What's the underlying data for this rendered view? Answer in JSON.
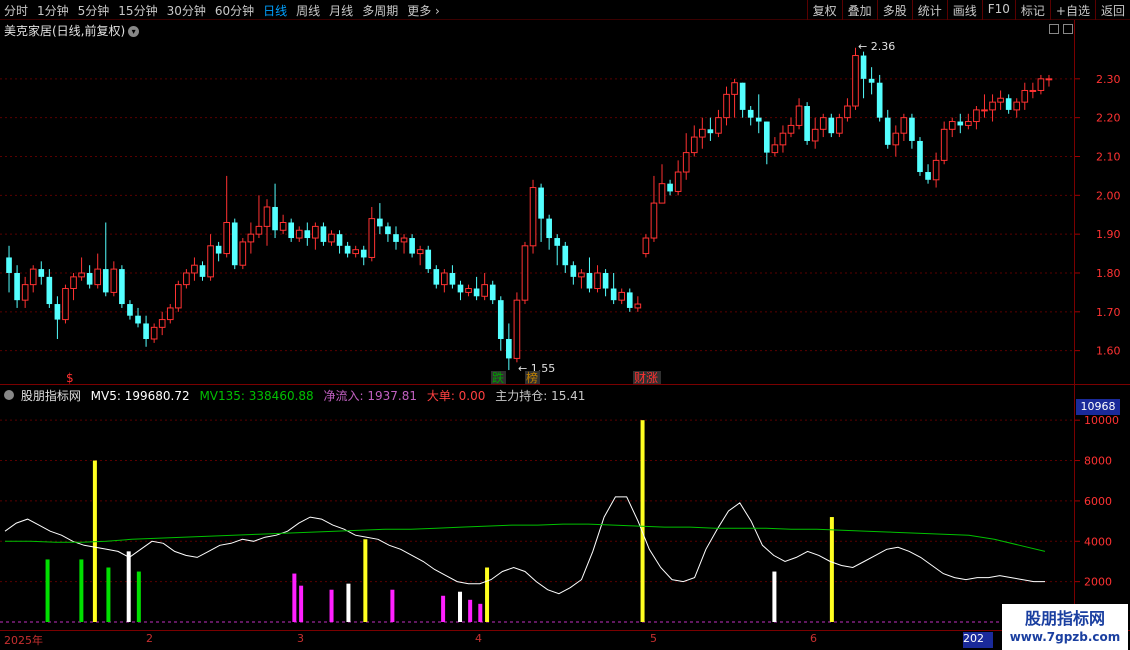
{
  "toolbar": {
    "periods": [
      {
        "label": "分时",
        "active": false
      },
      {
        "label": "1分钟",
        "active": false
      },
      {
        "label": "5分钟",
        "active": false
      },
      {
        "label": "15分钟",
        "active": false
      },
      {
        "label": "30分钟",
        "active": false
      },
      {
        "label": "60分钟",
        "active": false
      },
      {
        "label": "日线",
        "active": true
      },
      {
        "label": "周线",
        "active": false
      },
      {
        "label": "月线",
        "active": false
      },
      {
        "label": "多周期",
        "active": false
      },
      {
        "label": "更多",
        "active": false
      }
    ],
    "buttons": [
      "复权",
      "叠加",
      "多股",
      "统计",
      "画线",
      "F10",
      "标记",
      "+自选",
      "返回"
    ]
  },
  "price_panel": {
    "title": "美克家居(日线,前复权)",
    "y_ticks": [
      "2.30",
      "2.20",
      "2.10",
      "2.00",
      "1.90",
      "1.80",
      "1.70",
      "1.60"
    ],
    "high_label": "2.36",
    "low_label": "1.55",
    "event_labels": [
      {
        "text": "$",
        "color": "#ff3030"
      },
      {
        "text": "跌",
        "color": "#00a000"
      },
      {
        "text": "榜",
        "color": "#c08000"
      },
      {
        "text": "财涨",
        "color": "#ff3030"
      }
    ]
  },
  "indicator": {
    "name": "股朋指标网",
    "mv5": "MV5: 199680.72",
    "mv135": "MV135: 338460.88",
    "net_inflow": "净流入: 1937.81",
    "big_order": "大单: 0.00",
    "main_position": "主力持仓: 15.41",
    "y_ticks": [
      "10000",
      "8000",
      "6000",
      "4000",
      "2000"
    ],
    "current_box": "10968",
    "colors": {
      "mv5": "#ffffff",
      "mv135": "#00c000",
      "net_inflow": "#c060c0",
      "big_order": "#ff4040",
      "main_position": "#c8c8c8"
    }
  },
  "date_axis": {
    "labels": [
      "2025年",
      "2",
      "3",
      "4",
      "5",
      "6"
    ],
    "cursor_box": "202"
  },
  "watermark": {
    "line1": "股朋指标网",
    "line2": "www.7gpzb.com"
  },
  "colors": {
    "up": "#ff3232",
    "down": "#54ffff",
    "grid": "#5a0000",
    "axis_text": "#ff3232"
  },
  "chart_data": [
    {
      "type": "candlestick",
      "price_range": [
        1.55,
        2.36
      ],
      "ylim": [
        1.545,
        2.4
      ],
      "candles": [
        [
          1.84,
          1.8,
          1.87,
          1.75
        ],
        [
          1.8,
          1.73,
          1.82,
          1.71
        ],
        [
          1.73,
          1.77,
          1.79,
          1.71
        ],
        [
          1.77,
          1.81,
          1.82,
          1.75
        ],
        [
          1.81,
          1.79,
          1.83,
          1.77
        ],
        [
          1.79,
          1.72,
          1.81,
          1.71
        ],
        [
          1.72,
          1.68,
          1.74,
          1.63
        ],
        [
          1.68,
          1.76,
          1.77,
          1.67
        ],
        [
          1.76,
          1.79,
          1.8,
          1.73
        ],
        [
          1.79,
          1.8,
          1.84,
          1.78
        ],
        [
          1.8,
          1.77,
          1.82,
          1.76
        ],
        [
          1.77,
          1.81,
          1.85,
          1.76
        ],
        [
          1.81,
          1.75,
          1.93,
          1.74
        ],
        [
          1.75,
          1.81,
          1.83,
          1.74
        ],
        [
          1.81,
          1.72,
          1.82,
          1.71
        ],
        [
          1.72,
          1.69,
          1.73,
          1.68
        ],
        [
          1.69,
          1.67,
          1.71,
          1.66
        ],
        [
          1.67,
          1.63,
          1.69,
          1.61
        ],
        [
          1.63,
          1.66,
          1.67,
          1.62
        ],
        [
          1.66,
          1.68,
          1.7,
          1.64
        ],
        [
          1.68,
          1.71,
          1.72,
          1.67
        ],
        [
          1.71,
          1.77,
          1.78,
          1.7
        ],
        [
          1.77,
          1.8,
          1.81,
          1.76
        ],
        [
          1.8,
          1.82,
          1.84,
          1.78
        ],
        [
          1.82,
          1.79,
          1.83,
          1.78
        ],
        [
          1.79,
          1.87,
          1.9,
          1.78
        ],
        [
          1.87,
          1.85,
          1.88,
          1.83
        ],
        [
          1.85,
          1.93,
          2.05,
          1.84
        ],
        [
          1.93,
          1.82,
          1.94,
          1.81
        ],
        [
          1.82,
          1.88,
          1.89,
          1.81
        ],
        [
          1.88,
          1.9,
          1.93,
          1.85
        ],
        [
          1.9,
          1.92,
          2.0,
          1.89
        ],
        [
          1.92,
          1.97,
          1.99,
          1.87
        ],
        [
          1.97,
          1.91,
          2.03,
          1.89
        ],
        [
          1.91,
          1.93,
          1.95,
          1.9
        ],
        [
          1.93,
          1.89,
          1.94,
          1.88
        ],
        [
          1.89,
          1.91,
          1.92,
          1.88
        ],
        [
          1.91,
          1.89,
          1.93,
          1.87
        ],
        [
          1.89,
          1.92,
          1.93,
          1.86
        ],
        [
          1.92,
          1.88,
          1.93,
          1.87
        ],
        [
          1.88,
          1.9,
          1.91,
          1.87
        ],
        [
          1.9,
          1.87,
          1.91,
          1.85
        ],
        [
          1.87,
          1.85,
          1.88,
          1.84
        ],
        [
          1.85,
          1.86,
          1.87,
          1.84
        ],
        [
          1.86,
          1.84,
          1.87,
          1.82
        ],
        [
          1.84,
          1.94,
          1.97,
          1.83
        ],
        [
          1.94,
          1.92,
          1.98,
          1.9
        ],
        [
          1.92,
          1.9,
          1.93,
          1.88
        ],
        [
          1.9,
          1.88,
          1.92,
          1.86
        ],
        [
          1.88,
          1.89,
          1.9,
          1.85
        ],
        [
          1.89,
          1.85,
          1.9,
          1.84
        ],
        [
          1.85,
          1.86,
          1.87,
          1.82
        ],
        [
          1.86,
          1.81,
          1.87,
          1.8
        ],
        [
          1.81,
          1.77,
          1.82,
          1.76
        ],
        [
          1.77,
          1.8,
          1.81,
          1.75
        ],
        [
          1.8,
          1.77,
          1.82,
          1.76
        ],
        [
          1.77,
          1.75,
          1.78,
          1.73
        ],
        [
          1.75,
          1.76,
          1.77,
          1.74
        ],
        [
          1.76,
          1.74,
          1.79,
          1.73
        ],
        [
          1.74,
          1.77,
          1.8,
          1.73
        ],
        [
          1.77,
          1.73,
          1.78,
          1.72
        ],
        [
          1.73,
          1.63,
          1.74,
          1.6
        ],
        [
          1.63,
          1.58,
          1.67,
          1.55
        ],
        [
          1.58,
          1.73,
          1.75,
          1.57
        ],
        [
          1.73,
          1.87,
          1.88,
          1.72
        ],
        [
          1.87,
          2.02,
          2.04,
          1.85
        ],
        [
          2.02,
          1.94,
          2.03,
          1.88
        ],
        [
          1.94,
          1.89,
          1.95,
          1.86
        ],
        [
          1.89,
          1.87,
          1.9,
          1.82
        ],
        [
          1.87,
          1.82,
          1.88,
          1.8
        ],
        [
          1.82,
          1.79,
          1.83,
          1.77
        ],
        [
          1.79,
          1.8,
          1.81,
          1.76
        ],
        [
          1.8,
          1.76,
          1.84,
          1.75
        ],
        [
          1.76,
          1.8,
          1.82,
          1.75
        ],
        [
          1.8,
          1.76,
          1.81,
          1.74
        ],
        [
          1.76,
          1.73,
          1.8,
          1.72
        ],
        [
          1.73,
          1.75,
          1.76,
          1.72
        ],
        [
          1.75,
          1.71,
          1.76,
          1.7
        ],
        [
          1.71,
          1.72,
          1.74,
          1.7
        ],
        [
          1.85,
          1.89,
          1.9,
          1.84
        ],
        [
          1.89,
          1.98,
          2.05,
          1.88
        ],
        [
          1.98,
          2.03,
          2.08,
          2.01
        ],
        [
          2.03,
          2.01,
          2.04,
          2.0
        ],
        [
          2.01,
          2.06,
          2.09,
          2.0
        ],
        [
          2.06,
          2.11,
          2.16,
          2.04
        ],
        [
          2.11,
          2.15,
          2.18,
          2.1
        ],
        [
          2.15,
          2.17,
          2.2,
          2.12
        ],
        [
          2.17,
          2.16,
          2.2,
          2.14
        ],
        [
          2.16,
          2.2,
          2.22,
          2.15
        ],
        [
          2.2,
          2.26,
          2.28,
          2.18
        ],
        [
          2.26,
          2.29,
          2.3,
          2.2
        ],
        [
          2.29,
          2.22,
          2.29,
          2.2
        ],
        [
          2.22,
          2.2,
          2.23,
          2.18
        ],
        [
          2.2,
          2.19,
          2.26,
          2.16
        ],
        [
          2.19,
          2.11,
          2.19,
          2.08
        ],
        [
          2.11,
          2.13,
          2.15,
          2.1
        ],
        [
          2.13,
          2.16,
          2.18,
          2.11
        ],
        [
          2.16,
          2.18,
          2.2,
          2.15
        ],
        [
          2.18,
          2.23,
          2.25,
          2.17
        ],
        [
          2.23,
          2.14,
          2.24,
          2.13
        ],
        [
          2.14,
          2.17,
          2.2,
          2.12
        ],
        [
          2.17,
          2.2,
          2.21,
          2.15
        ],
        [
          2.2,
          2.16,
          2.21,
          2.15
        ],
        [
          2.16,
          2.2,
          2.21,
          2.15
        ],
        [
          2.2,
          2.23,
          2.25,
          2.19
        ],
        [
          2.23,
          2.36,
          2.38,
          2.22
        ],
        [
          2.36,
          2.3,
          2.37,
          2.25
        ],
        [
          2.3,
          2.29,
          2.33,
          2.26
        ],
        [
          2.29,
          2.2,
          2.31,
          2.19
        ],
        [
          2.2,
          2.13,
          2.22,
          2.12
        ],
        [
          2.13,
          2.16,
          2.18,
          2.1
        ],
        [
          2.16,
          2.2,
          2.21,
          2.14
        ],
        [
          2.2,
          2.14,
          2.21,
          2.12
        ],
        [
          2.14,
          2.06,
          2.15,
          2.05
        ],
        [
          2.06,
          2.04,
          2.08,
          2.03
        ],
        [
          2.04,
          2.09,
          2.11,
          2.02
        ],
        [
          2.09,
          2.17,
          2.19,
          2.08
        ],
        [
          2.17,
          2.19,
          2.2,
          2.15
        ],
        [
          2.19,
          2.18,
          2.21,
          2.16
        ],
        [
          2.18,
          2.19,
          2.21,
          2.17
        ],
        [
          2.19,
          2.22,
          2.23,
          2.17
        ],
        [
          2.22,
          2.22,
          2.26,
          2.2
        ],
        [
          2.22,
          2.24,
          2.26,
          2.19
        ],
        [
          2.24,
          2.25,
          2.27,
          2.22
        ],
        [
          2.25,
          2.22,
          2.26,
          2.21
        ],
        [
          2.22,
          2.24,
          2.25,
          2.2
        ],
        [
          2.24,
          2.27,
          2.29,
          2.22
        ],
        [
          2.27,
          2.27,
          2.29,
          2.25
        ],
        [
          2.27,
          2.3,
          2.31,
          2.26
        ],
        [
          2.3,
          2.3,
          2.31,
          2.28
        ]
      ]
    },
    {
      "type": "bar+line",
      "ylim": [
        0,
        11000
      ],
      "mv5": [
        4500,
        4900,
        5100,
        4800,
        4500,
        4300,
        4000,
        3800,
        3700,
        3600,
        3500,
        3200,
        3600,
        4000,
        3900,
        3500,
        3300,
        3200,
        3500,
        3800,
        3900,
        4100,
        4000,
        4200,
        4300,
        4500,
        4900,
        5200,
        5100,
        4800,
        4600,
        4300,
        4200,
        4100,
        3800,
        3600,
        3300,
        3000,
        2600,
        2300,
        2000,
        1900,
        1900,
        2100,
        2500,
        2700,
        2500,
        2000,
        1600,
        1400,
        1700,
        2100,
        3500,
        5200,
        6200,
        6200,
        5000,
        3600,
        2700,
        2100,
        2000,
        2200,
        3600,
        4600,
        5500,
        5900,
        5000,
        3800,
        3300,
        3000,
        3200,
        3500,
        3300,
        3000,
        2800,
        2700,
        3000,
        3300,
        3600,
        3700,
        3500,
        3200,
        2800,
        2400,
        2200,
        2100,
        2200,
        2200,
        2300,
        2200,
        2100,
        2000,
        2000
      ],
      "mv135": [
        4000,
        4000,
        3950,
        3950,
        4000,
        4100,
        4150,
        4200,
        4250,
        4300,
        4350,
        4400,
        4450,
        4500,
        4550,
        4600,
        4600,
        4650,
        4700,
        4750,
        4800,
        4800,
        4850,
        4850,
        4800,
        4750,
        4700,
        4700,
        4650,
        4650,
        4650,
        4600,
        4600,
        4550,
        4500,
        4450,
        4400,
        4350,
        4300,
        4100,
        3800,
        3500
      ],
      "bars": [
        {
          "i": 12,
          "v": 3100,
          "c": "#00e000"
        },
        {
          "i": 22,
          "v": 3100,
          "c": "#00e000"
        },
        {
          "i": 26,
          "v": 8000,
          "c": "#ffff20"
        },
        {
          "i": 30,
          "v": 2700,
          "c": "#00e000"
        },
        {
          "i": 36,
          "v": 3500,
          "c": "#ffffff"
        },
        {
          "i": 39,
          "v": 2500,
          "c": "#00e000"
        },
        {
          "i": 85,
          "v": 2400,
          "c": "#ff20ff"
        },
        {
          "i": 87,
          "v": 1800,
          "c": "#ff20ff"
        },
        {
          "i": 96,
          "v": 1600,
          "c": "#ff20ff"
        },
        {
          "i": 101,
          "v": 1900,
          "c": "#ffffff"
        },
        {
          "i": 106,
          "v": 4100,
          "c": "#ffff20"
        },
        {
          "i": 114,
          "v": 1600,
          "c": "#ff20ff"
        },
        {
          "i": 129,
          "v": 1300,
          "c": "#ff20ff"
        },
        {
          "i": 134,
          "v": 1500,
          "c": "#ffffff"
        },
        {
          "i": 137,
          "v": 1100,
          "c": "#ff20ff"
        },
        {
          "i": 140,
          "v": 900,
          "c": "#ff20ff"
        },
        {
          "i": 142,
          "v": 2700,
          "c": "#ffff20"
        },
        {
          "i": 188,
          "v": 10000,
          "c": "#ffff20"
        },
        {
          "i": 227,
          "v": 2500,
          "c": "#ffffff"
        },
        {
          "i": 244,
          "v": 5200,
          "c": "#ffff20"
        },
        {
          "i": 295,
          "v": 700,
          "c": "#ffffff"
        },
        {
          "i": 298,
          "v": 600,
          "c": "#00e000"
        }
      ]
    }
  ]
}
